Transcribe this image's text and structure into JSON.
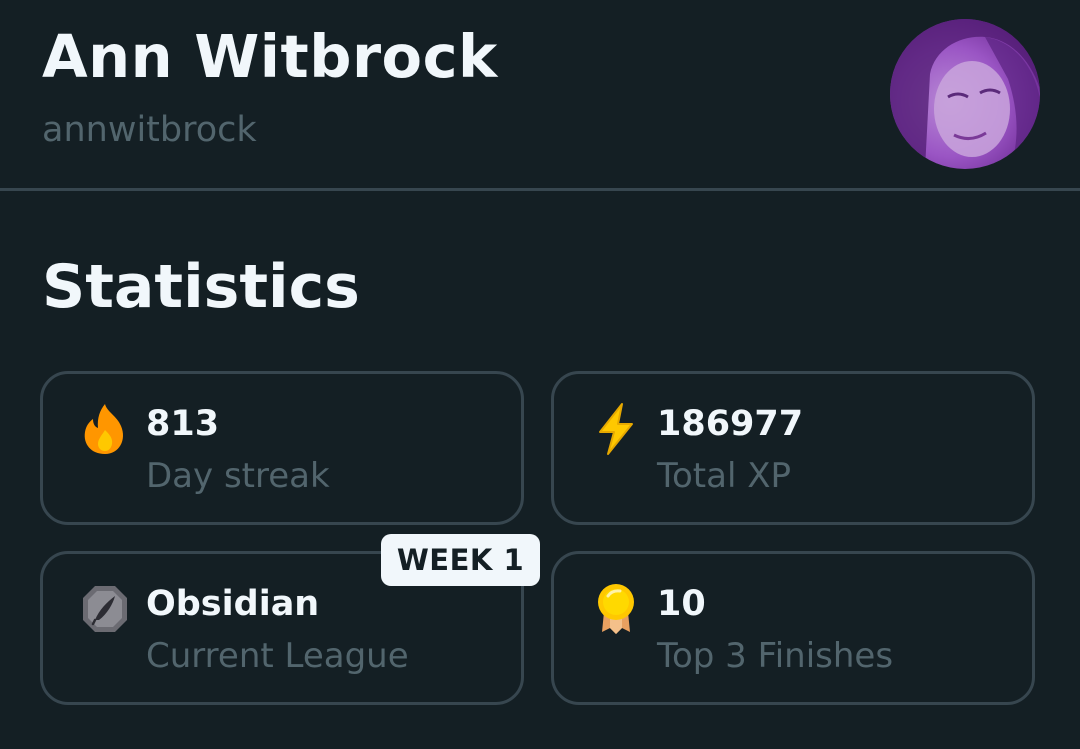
{
  "profile": {
    "name": "Ann Witbrock",
    "username": "annwitbrock",
    "avatar_icon": "profile-photo"
  },
  "statistics": {
    "title": "Statistics",
    "cards": [
      {
        "value": "813",
        "label": "Day streak",
        "icon": "fire-icon",
        "color": "#ff9600"
      },
      {
        "value": "186977",
        "label": "Total XP",
        "icon": "lightning-icon",
        "color": "#ffc800"
      },
      {
        "value": "Obsidian",
        "label": "Current League",
        "icon": "obsidian-league-icon",
        "color": "#8a8a8e",
        "badge": "WEEK 1"
      },
      {
        "value": "10",
        "label": "Top 3 Finishes",
        "icon": "medal-icon",
        "color": "#ffd900"
      }
    ]
  },
  "colors": {
    "background": "#141f24",
    "border": "#37464f",
    "muted_text": "#52656d",
    "text": "#f1f7fb"
  }
}
